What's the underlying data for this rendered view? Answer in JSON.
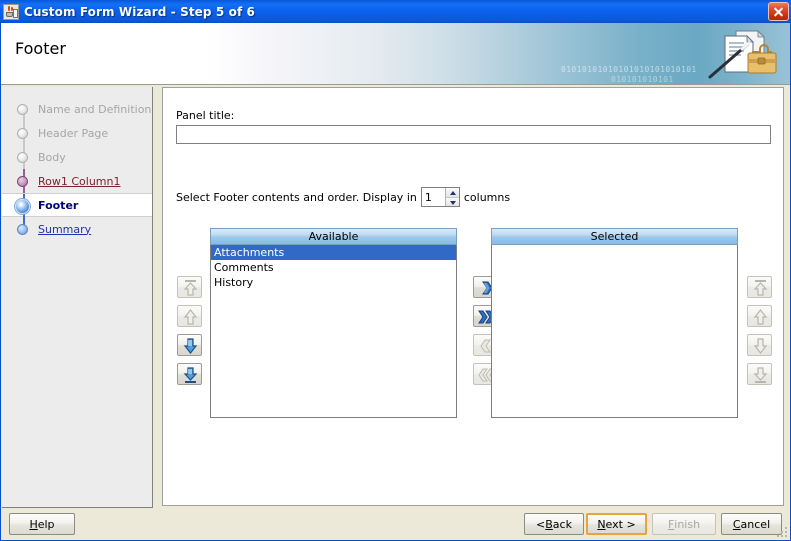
{
  "window": {
    "title": "Custom Form Wizard - Step 5 of 6",
    "app_icon": "java-coffee-cup-icon",
    "close_label": "Close"
  },
  "header": {
    "title": "Footer",
    "banner_binary_row1": "01010101010101010101010101",
    "banner_binary_row2": "010101010101",
    "banner_art": "documents-wand-briefcase-illustration"
  },
  "sidebar": {
    "steps": [
      {
        "label": "Name and Definition",
        "state": "disabled",
        "dot": "gray"
      },
      {
        "label": "Header Page",
        "state": "disabled",
        "dot": "gray"
      },
      {
        "label": "Body",
        "state": "disabled",
        "dot": "gray"
      },
      {
        "label": "Row1 Column1",
        "state": "visited",
        "dot": "mauve"
      },
      {
        "label": "Footer",
        "state": "current",
        "dot": "blue-ring"
      },
      {
        "label": "Summary",
        "state": "link",
        "dot": "blue"
      }
    ]
  },
  "main": {
    "panel_title_label": "Panel title:",
    "panel_title_value": "",
    "panel_title_placeholder": "",
    "order_text_prefix": "Select Footer contents and order.  Display in",
    "columns_value": "1",
    "order_text_suffix": "columns",
    "available": {
      "header": "Available",
      "items": [
        "Attachments",
        "Comments",
        "History"
      ],
      "selected_index": 0
    },
    "selected": {
      "header": "Selected",
      "items": []
    },
    "left_order_buttons": [
      {
        "name": "move-to-top-button",
        "icon": "arrow-up-to-top-icon",
        "enabled": false
      },
      {
        "name": "move-up-button",
        "icon": "arrow-up-icon",
        "enabled": false
      },
      {
        "name": "move-down-button",
        "icon": "arrow-down-icon",
        "enabled": true
      },
      {
        "name": "move-to-bottom-button",
        "icon": "arrow-down-to-bottom-icon",
        "enabled": true
      }
    ],
    "transfer_buttons": [
      {
        "name": "move-right-button",
        "icon": "chevron-right-icon",
        "enabled": true
      },
      {
        "name": "move-all-right-button",
        "icon": "chevrons-right-icon",
        "enabled": true
      },
      {
        "name": "move-left-button",
        "icon": "chevron-left-icon",
        "enabled": false
      },
      {
        "name": "move-all-left-button",
        "icon": "chevrons-left-icon",
        "enabled": false
      }
    ],
    "right_order_buttons": [
      {
        "name": "selected-move-to-top-button",
        "icon": "arrow-up-to-top-icon",
        "enabled": false
      },
      {
        "name": "selected-move-up-button",
        "icon": "arrow-up-icon",
        "enabled": false
      },
      {
        "name": "selected-move-down-button",
        "icon": "arrow-down-icon",
        "enabled": false
      },
      {
        "name": "selected-move-to-bottom-button",
        "icon": "arrow-down-to-bottom-icon",
        "enabled": false
      }
    ]
  },
  "footer_buttons": {
    "help": {
      "prefix": "",
      "mnemonic": "H",
      "suffix": "elp"
    },
    "back": {
      "prefix": "< ",
      "mnemonic": "B",
      "suffix": "ack"
    },
    "next": {
      "prefix": "",
      "mnemonic": "N",
      "suffix": "ext >"
    },
    "finish": {
      "prefix": "",
      "mnemonic": "F",
      "suffix": "inish"
    },
    "cancel": {
      "prefix": "",
      "mnemonic": "C",
      "suffix": "ancel"
    }
  },
  "colors": {
    "titlebar_blue": "#0a5ce4",
    "selection_blue": "#3169c6",
    "current_step_navy": "#00007a",
    "visited_step_maroon": "#7c2230",
    "link_blue": "#2330b0",
    "focus_orange": "#e8a33d",
    "close_red": "#c52f14",
    "dialog_bg": "#ece9d8"
  }
}
